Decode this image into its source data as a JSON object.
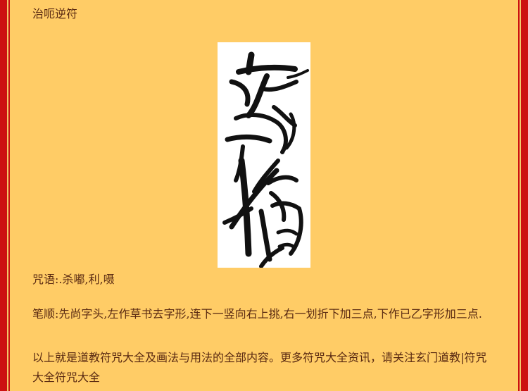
{
  "article": {
    "title": "治呃逆符",
    "incantation": "咒语:.杀嘟,利,嗫",
    "stroke_order": "笔顺:先尚字头,左作草书去字形,连下一竖向右上挑,右一划折下加三点,下作已乙字形加三点.",
    "footer_note": "以上就是道教符咒大全及画法与用法的全部内容。更多符咒大全资讯，请关注玄门道教|符咒大全符咒大全"
  },
  "colors": {
    "background": "#ffcc66",
    "frame": "#cc1111",
    "text": "#5a2a12",
    "ink": "#111111"
  }
}
